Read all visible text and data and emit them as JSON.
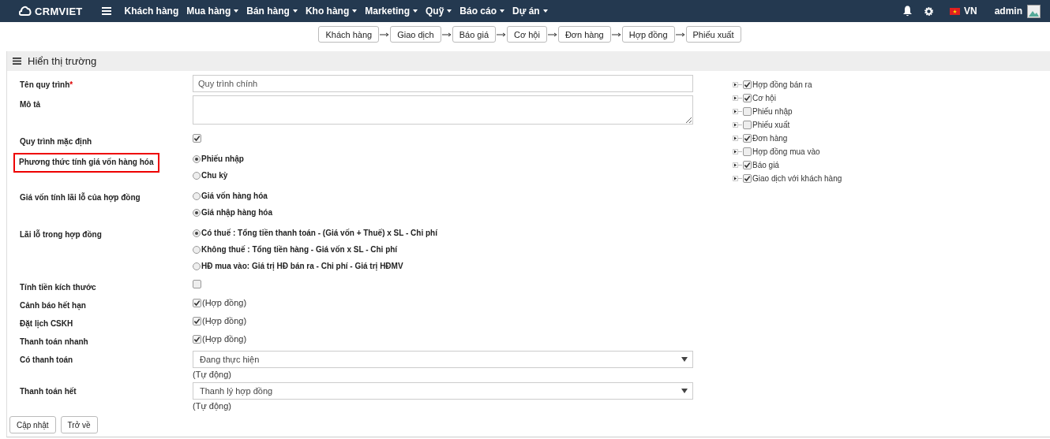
{
  "navbar": {
    "logo": "CRMVIET",
    "menu": [
      {
        "label": "Khách hàng",
        "dropdown": false
      },
      {
        "label": "Mua hàng",
        "dropdown": true
      },
      {
        "label": "Bán hàng",
        "dropdown": true
      },
      {
        "label": "Kho hàng",
        "dropdown": true
      },
      {
        "label": "Marketing",
        "dropdown": true
      },
      {
        "label": "Quỹ",
        "dropdown": true
      },
      {
        "label": "Báo cáo",
        "dropdown": true
      },
      {
        "label": "Dự án",
        "dropdown": true
      }
    ],
    "language": "VN",
    "user": "admin"
  },
  "steps": [
    "Khách hàng",
    "Giao dịch",
    "Báo giá",
    "Cơ hội",
    "Đơn hàng",
    "Hợp đồng",
    "Phiếu xuất"
  ],
  "panel": {
    "title": "Hiển thị trường"
  },
  "form": [
    {
      "kind": "text",
      "label": "Tên quy trình",
      "required_mark": "*",
      "value": "Quy trình chính",
      "highlighted": false
    },
    {
      "kind": "textarea",
      "label": "Mô tả",
      "highlighted": false
    },
    {
      "kind": "checkbox",
      "label": "Quy trình mặc định",
      "checked": true,
      "highlighted": false
    },
    {
      "kind": "radio",
      "label": "Phương thức tính giá vốn hàng hóa",
      "highlighted": true,
      "options": [
        {
          "label": "Phiếu nhập",
          "selected": true
        },
        {
          "label": "Chu kỳ",
          "selected": false
        }
      ]
    },
    {
      "kind": "radio",
      "label": "Giá vốn tính lãi lỗ của hợp đồng",
      "highlighted": false,
      "options": [
        {
          "label": "Giá vốn hàng hóa",
          "selected": false
        },
        {
          "label": "Giá nhập hàng hóa",
          "selected": true
        }
      ]
    },
    {
      "kind": "radio",
      "label": "Lãi lỗ trong hợp đồng",
      "highlighted": false,
      "options": [
        {
          "label": "Có thuế : Tổng tiền thanh toán - (Giá vốn + Thuế) x SL - Chi phí",
          "selected": true
        },
        {
          "label": "Không thuế : Tổng tiền hàng - Giá vốn x SL - Chi phí",
          "selected": false
        },
        {
          "label": "HĐ mua vào: Giá trị HĐ bán ra - Chi phí - Giá trị HĐMV",
          "selected": false
        }
      ]
    },
    {
      "kind": "checkbox",
      "label": "Tính tiền kích thước",
      "checked": false,
      "highlighted": false
    },
    {
      "kind": "checkbox",
      "label": "Cảnh báo hết hạn",
      "checked": true,
      "note": "(Hợp đồng)",
      "highlighted": false
    },
    {
      "kind": "checkbox",
      "label": "Đặt lịch CSKH",
      "checked": true,
      "note": "(Hợp đồng)",
      "highlighted": false
    },
    {
      "kind": "checkbox",
      "label": "Thanh toán nhanh",
      "checked": true,
      "note": "(Hợp đồng)",
      "highlighted": false
    },
    {
      "kind": "select",
      "label": "Có thanh toán",
      "value": "Đang thực hiện",
      "note": "(Tự động)",
      "highlighted": false
    },
    {
      "kind": "select",
      "label": "Thanh toán hết",
      "value": "Thanh lý hợp đồng",
      "note": "(Tự động)",
      "highlighted": false
    }
  ],
  "tree": [
    {
      "label": "Hợp đồng bán ra",
      "checked": true
    },
    {
      "label": "Cơ hội",
      "checked": true
    },
    {
      "label": "Phiếu nhập",
      "checked": false
    },
    {
      "label": "Phiếu xuất",
      "checked": false
    },
    {
      "label": "Đơn hàng",
      "checked": true
    },
    {
      "label": "Hợp đồng mua vào",
      "checked": false
    },
    {
      "label": "Báo giá",
      "checked": true
    },
    {
      "label": "Giao dịch với khách hàng",
      "checked": true
    }
  ],
  "buttons": [
    "Cập nhật",
    "Trở về"
  ]
}
